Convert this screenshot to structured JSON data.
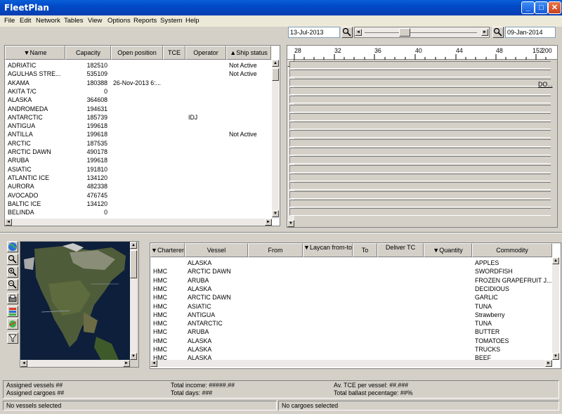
{
  "window": {
    "title": "FleetPlan"
  },
  "menu": [
    "File",
    "Edit",
    "Network",
    "Tables",
    "View",
    "Options",
    "Reports",
    "System",
    "Help"
  ],
  "timeline": {
    "start_date": "13-Jul-2013",
    "end_date": "09-Jan-2014",
    "ticks": [
      "28",
      "32",
      "36",
      "40",
      "44",
      "48",
      "1",
      "52",
      "200"
    ],
    "marker_label": "DO..."
  },
  "ships": {
    "columns": [
      "▼Name",
      "Capacity",
      "Open position",
      "TCE",
      "Operator",
      "▲Ship status"
    ],
    "rows": [
      {
        "name": "ADRIATIC",
        "capacity": "182510",
        "open_position": "",
        "operator": "",
        "status": "Not Active"
      },
      {
        "name": "AGULHAS STRE...",
        "capacity": "535109",
        "open_position": "",
        "operator": "",
        "status": "Not Active"
      },
      {
        "name": "AKAMA",
        "capacity": "180388",
        "open_position": "26-Nov-2013 6:...",
        "operator": "",
        "status": ""
      },
      {
        "name": "AKITA T/C",
        "capacity": "0",
        "open_position": "",
        "operator": "",
        "status": ""
      },
      {
        "name": "ALASKA",
        "capacity": "364608",
        "open_position": "",
        "operator": "",
        "status": ""
      },
      {
        "name": "ANDROMEDA",
        "capacity": "194631",
        "open_position": "",
        "operator": "",
        "status": ""
      },
      {
        "name": "ANTARCTIC",
        "capacity": "185739",
        "open_position": "",
        "operator": "IDJ",
        "status": ""
      },
      {
        "name": "ANTIGUA",
        "capacity": "199618",
        "open_position": "",
        "operator": "",
        "status": ""
      },
      {
        "name": "ANTILLA",
        "capacity": "199618",
        "open_position": "",
        "operator": "",
        "status": "Not Active"
      },
      {
        "name": "ARCTIC",
        "capacity": "187535",
        "open_position": "",
        "operator": "",
        "status": ""
      },
      {
        "name": "ARCTIC DAWN",
        "capacity": "490178",
        "open_position": "",
        "operator": "",
        "status": ""
      },
      {
        "name": "ARUBA",
        "capacity": "199618",
        "open_position": "",
        "operator": "",
        "status": ""
      },
      {
        "name": "ASIATIC",
        "capacity": "191810",
        "open_position": "",
        "operator": "",
        "status": ""
      },
      {
        "name": "ATLANTIC ICE",
        "capacity": "134120",
        "open_position": "",
        "operator": "",
        "status": ""
      },
      {
        "name": "AURORA",
        "capacity": "482338",
        "open_position": "",
        "operator": "",
        "status": ""
      },
      {
        "name": "AVOCADO",
        "capacity": "476745",
        "open_position": "",
        "operator": "",
        "status": ""
      },
      {
        "name": "BALTIC ICE",
        "capacity": "134120",
        "open_position": "",
        "operator": "",
        "status": ""
      },
      {
        "name": "BELINDA",
        "capacity": "0",
        "open_position": "",
        "operator": "",
        "status": ""
      }
    ]
  },
  "map_tools": [
    "globe-icon",
    "zoom-icon",
    "zoom-in-icon",
    "zoom-out-icon",
    "print-icon",
    "layers-icon",
    "world-icon",
    "filter-icon"
  ],
  "cargoes": {
    "columns": [
      "▼Charterer",
      "Vessel",
      "From",
      "▼Laycan from-to",
      "To",
      "Deliver TC",
      "▼Quantity",
      "Commodity"
    ],
    "rows": [
      {
        "charterer": "",
        "vessel": "ALASKA",
        "commodity": "APPLES"
      },
      {
        "charterer": "HMC",
        "vessel": "ARCTIC DAWN",
        "commodity": "SWORDFISH"
      },
      {
        "charterer": "HMC",
        "vessel": "ARUBA",
        "commodity": "FROZEN GRAPEFRUIT J..."
      },
      {
        "charterer": "HMC",
        "vessel": "ALASKA",
        "commodity": "DECIDIOUS"
      },
      {
        "charterer": "HMC",
        "vessel": "ARCTIC DAWN",
        "commodity": "GARLIC"
      },
      {
        "charterer": "HMC",
        "vessel": "ASIATIC",
        "commodity": "TUNA"
      },
      {
        "charterer": "HMC",
        "vessel": "ANTIGUA",
        "commodity": "Strawberry"
      },
      {
        "charterer": "HMC",
        "vessel": "ANTARCTIC",
        "commodity": "TUNA"
      },
      {
        "charterer": "HMC",
        "vessel": "ARUBA",
        "commodity": "BUTTER"
      },
      {
        "charterer": "HMC",
        "vessel": "ALASKA",
        "commodity": "TOMATOES"
      },
      {
        "charterer": "HMC",
        "vessel": "ALASKA",
        "commodity": "TRUCKS"
      },
      {
        "charterer": "HMC",
        "vessel": "ALASKA",
        "commodity": "BEEF"
      }
    ]
  },
  "summary": {
    "assigned_vessels": "Assigned vessels ##",
    "assigned_cargoes": "Assigned cargoes ##",
    "total_income": "Total income: #####.##",
    "total_days": "Total days: ###",
    "avg_tce": "Av. TCE per vessel: ##.###",
    "ballast": "Total ballast pecentage: ##%"
  },
  "status_bar": {
    "vessels": "No vessels selected",
    "cargoes": "No cargoes selected"
  }
}
